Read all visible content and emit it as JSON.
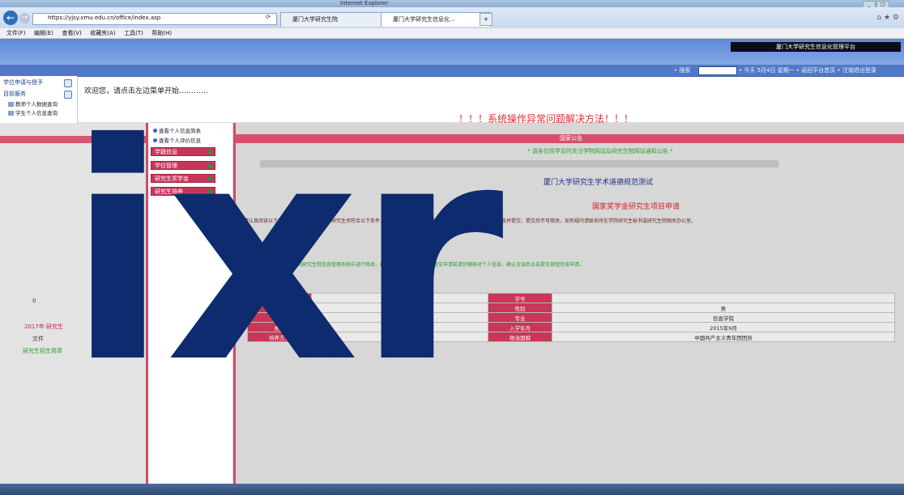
{
  "window": {
    "title": "Internet Explorer",
    "controls": [
      "_",
      "□",
      "✕"
    ]
  },
  "browser": {
    "address": "https://yjsy.xmu.edu.cn/office/index.asp",
    "tabs": [
      {
        "label": "厦门大学研究生院"
      },
      {
        "label": "厦门大学研究生信息化..."
      }
    ],
    "menu": [
      "文件(F)",
      "编辑(E)",
      "查看(V)",
      "收藏夹(A)",
      "工具(T)",
      "帮助(H)"
    ]
  },
  "banner": {
    "system_title": "厦门大学研究生信息化管理平台",
    "search_label": "• 搜索",
    "info_text": "• 今天 5月4日 星期一 • 返回平台首页 • 注销退出登录"
  },
  "leftnav": {
    "header1": "学位申请与授予",
    "header2": "目前服务",
    "items": [
      "教师个人数据查询",
      "学生个人信息查询"
    ]
  },
  "welcome": {
    "text": "欢迎您，请点击左边菜单开始…………",
    "notice": "！！！系统操作异常问题解决方法！！！"
  },
  "midcol": {
    "links": [
      "查看个人信息简表",
      "查看个人评价信息"
    ],
    "menus": [
      "学籍信息",
      "学位管理",
      "研究生奖学金",
      "研究生培养"
    ]
  },
  "leftcol": {
    "rows": [
      "0",
      "2017年·研究生",
      "文件",
      "研究生招生简章"
    ]
  },
  "main": {
    "header": "国家公告",
    "green_line": "* 请各位同学及时关注学院网站及研究生院网站通知公告 *",
    "test_title": "厦门大学研究生学术道德规范测试",
    "app_title": "国家奖学金研究生项目申请",
    "para": "请认真阅读以下说明：申请国家奖学金的研究生须符合以下条件，具体办法详见研究生院网站通知，请按要求填写申请信息并提交，提交后不可修改，如有疑问请联系所在学院研究生秘书或研究生院相关办公室。",
    "green_para": "注：如申请信息有误请先到研究生院信息管理系统中进行修改，核对无误后再进行申请。提交申请前请仔细核对个人信息，确认无误后点击提交按钮完成申请。"
  },
  "table": {
    "rows": [
      {
        "l1": "姓名",
        "v1": "",
        "l2": "学号",
        "v2": ""
      },
      {
        "l1": "身份证号",
        "v1": "",
        "l2": "性别",
        "v2": "男"
      },
      {
        "l1": "学院",
        "v1": "信息学院",
        "l2": "专业",
        "v2": "信息学院"
      },
      {
        "l1": "类别",
        "v1": "全日制学术",
        "l2": "入学年月",
        "v2": "2015年9月"
      },
      {
        "l1": "培养方式",
        "v1": "非定向",
        "l2": "政治面貌",
        "v2": "中国共产主义青年团团员"
      }
    ]
  },
  "overlay": {
    "text": "ixr"
  }
}
